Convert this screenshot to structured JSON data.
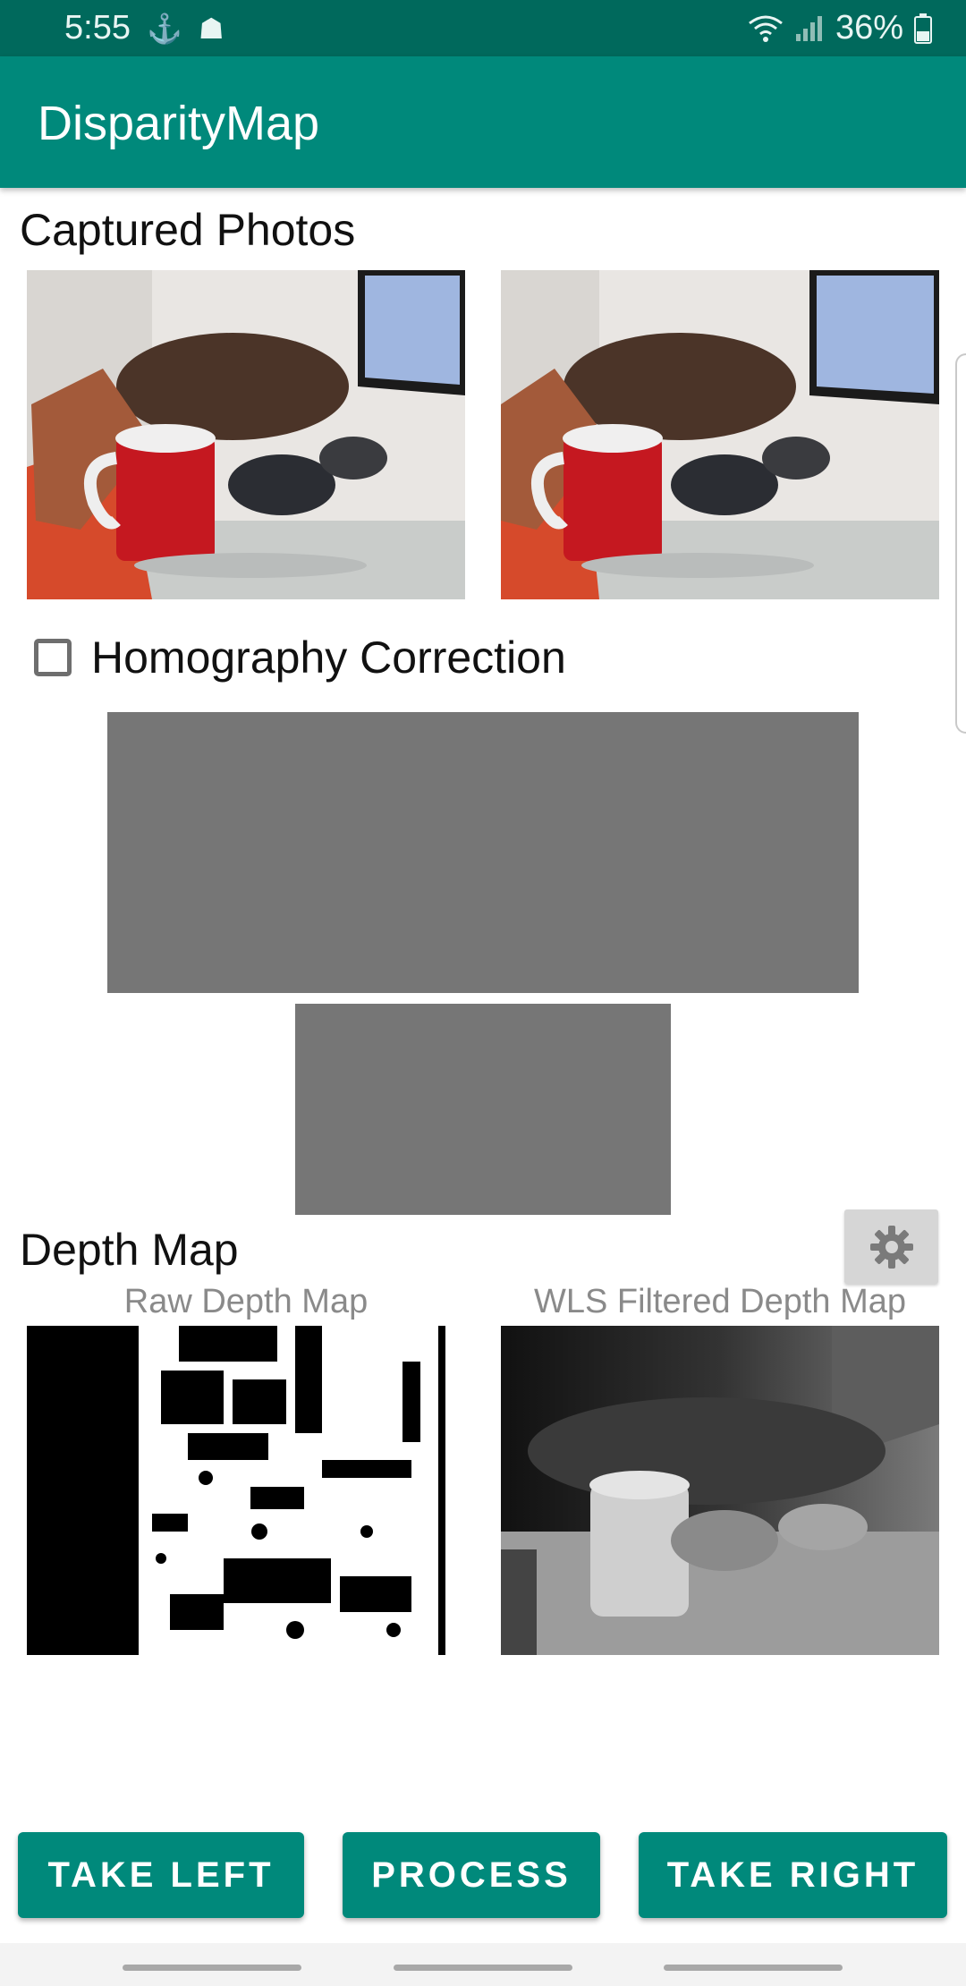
{
  "status_bar": {
    "time": "5:55",
    "battery": "36%"
  },
  "app_bar": {
    "title": "DisparityMap"
  },
  "captured": {
    "title": "Captured Photos"
  },
  "homography": {
    "label": "Homography Correction",
    "checked": false
  },
  "depth": {
    "title": "Depth Map",
    "raw_caption": "Raw Depth Map",
    "wls_caption": "WLS Filtered Depth Map"
  },
  "buttons": {
    "take_left": "TAKE LEFT",
    "process": "PROCESS",
    "take_right": "TAKE RIGHT"
  },
  "colors": {
    "primary": "#00897b",
    "primary_dark": "#00695c",
    "placeholder_gray": "#767676"
  },
  "icons": [
    "photo-icon",
    "signal-icon",
    "wifi-icon",
    "battery-icon",
    "gear-icon"
  ]
}
